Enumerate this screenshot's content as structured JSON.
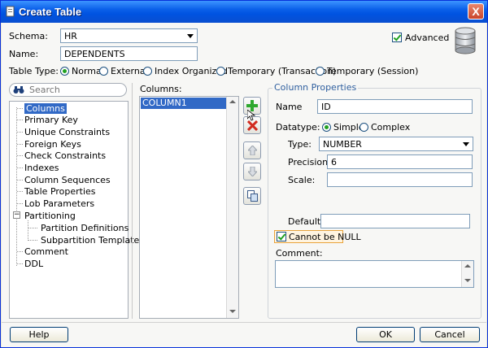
{
  "window": {
    "title": "Create Table",
    "close_label": "X"
  },
  "schema": {
    "label": "Schema:",
    "value": "HR"
  },
  "name": {
    "label": "Name:",
    "value": "DEPENDENTS"
  },
  "advanced": {
    "label": "Advanced",
    "checked": true
  },
  "table_type": {
    "label": "Table Type:",
    "options": [
      "Normal",
      "External",
      "Index Organized",
      "Temporary (Transaction)",
      "Temporary (Session)"
    ],
    "selected": "Normal"
  },
  "search": {
    "placeholder": "Search"
  },
  "tree": {
    "items": [
      "Columns",
      "Primary Key",
      "Unique Constraints",
      "Foreign Keys",
      "Check Constraints",
      "Indexes",
      "Column Sequences",
      "Table Properties",
      "Lob Parameters",
      "Partitioning",
      "Partition Definitions",
      "Subpartition Templates",
      "Comment",
      "DDL"
    ],
    "selected": "Columns"
  },
  "columns": {
    "label": "Columns:",
    "items": [
      "COLUMN1"
    ]
  },
  "column_properties": {
    "title": "Column Properties",
    "name_label": "Name",
    "name_value": "ID",
    "datatype_label": "Datatype:",
    "simple_label": "Simple",
    "complex_label": "Complex",
    "type_label": "Type:",
    "type_value": "NUMBER",
    "precision_label": "Precision:",
    "precision_value": "6",
    "scale_label": "Scale:",
    "scale_value": "",
    "default_label": "Default:",
    "default_value": "",
    "not_null_label": "Cannot be NULL",
    "not_null_checked": true,
    "comment_label": "Comment:",
    "comment_value": ""
  },
  "buttons": {
    "help": "Help",
    "ok": "OK",
    "cancel": "Cancel"
  },
  "icons": {
    "add": "add-column-icon",
    "remove": "remove-column-icon",
    "up": "move-up-icon",
    "down": "move-down-icon",
    "copy": "copy-icon",
    "database": "database-icon",
    "binoculars": "binoculars-icon"
  },
  "colors": {
    "title_bar": "#0a5fe8",
    "selection": "#3169c6",
    "add_green": "#2ea82e",
    "remove_red": "#d12b1f"
  }
}
